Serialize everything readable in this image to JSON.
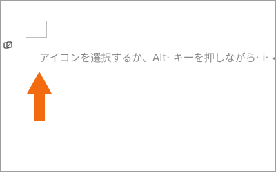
{
  "document": {
    "placeholder_text": "アイコンを選択するか、Alt· キーを押しながら· i· ",
    "trailing_mark": "◂"
  },
  "icons": {
    "margin_mark": "paragraph-anchor-icon",
    "arrow": "arrow-up-icon"
  },
  "colors": {
    "arrow": "#f26b10",
    "text": "#8a8a8a",
    "border": "#9e9e9e"
  }
}
